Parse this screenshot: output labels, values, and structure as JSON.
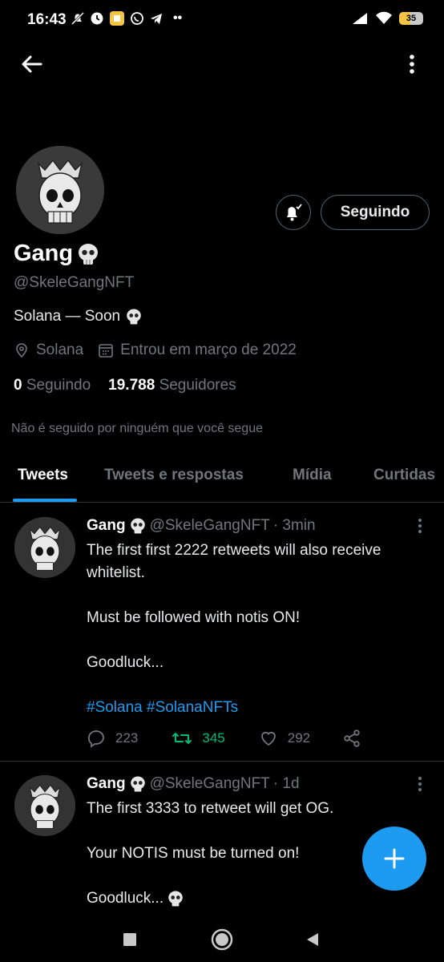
{
  "status_bar": {
    "time": "16:43",
    "battery": "35"
  },
  "profile": {
    "name": "Gang",
    "handle": "@SkeleGangNFT",
    "bio": "Solana — Soon",
    "location": "Solana",
    "joined": "Entrou em março de 2022",
    "following_count": "0",
    "following_label": "Seguindo",
    "followers_count": "19.788",
    "followers_label": "Seguidores",
    "not_followed_note": "Não é seguido por ninguém que você segue",
    "follow_button": "Seguindo"
  },
  "tabs": [
    {
      "label": "Tweets"
    },
    {
      "label": "Tweets e respostas"
    },
    {
      "label": "Mídia"
    },
    {
      "label": "Curtidas"
    }
  ],
  "tweets": [
    {
      "name": "Gang",
      "handle": "@SkeleGangNFT",
      "time": "· 3min",
      "line1": "The first first 2222 retweets will also receive",
      "line2": "whitelist.",
      "line3": "Must be followed with notis ON!",
      "line4": "Goodluck...",
      "tags": "#Solana #SolanaNFTs",
      "replies": "223",
      "retweets": "345",
      "likes": "292"
    },
    {
      "name": "Gang",
      "handle": "@SkeleGangNFT",
      "time": "· 1d",
      "line1": "The first 3333 to retweet will get OG.",
      "line2": "Your NOTIS must be turned on!",
      "line3": "Goodluck..."
    }
  ],
  "colors": {
    "accent": "#1d9bf0",
    "retweet_active": "#00ba7c",
    "muted": "#71767b",
    "background": "#000000"
  }
}
